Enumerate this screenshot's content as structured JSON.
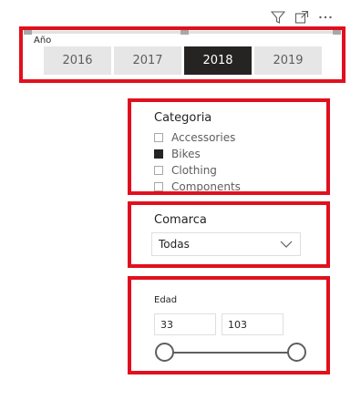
{
  "header_icons": [
    "filter-icon",
    "focus-mode-icon",
    "more-options-icon"
  ],
  "year_slicer": {
    "title": "Año",
    "options": [
      {
        "label": "2016",
        "selected": false
      },
      {
        "label": "2017",
        "selected": false
      },
      {
        "label": "2018",
        "selected": true
      },
      {
        "label": "2019",
        "selected": false
      }
    ]
  },
  "categoria_slicer": {
    "title": "Categoria",
    "items": [
      {
        "label": "Accessories",
        "checked": false
      },
      {
        "label": "Bikes",
        "checked": true
      },
      {
        "label": "Clothing",
        "checked": false
      },
      {
        "label": "Components",
        "checked": false
      }
    ]
  },
  "comarca_slicer": {
    "title": "Comarca",
    "selected_value": "Todas"
  },
  "edad_slicer": {
    "title": "Edad",
    "min_value": "33",
    "max_value": "103"
  },
  "colors": {
    "highlight_border": "#e1101e",
    "selected_tile": "#252423",
    "tile": "#e6e6e6"
  }
}
